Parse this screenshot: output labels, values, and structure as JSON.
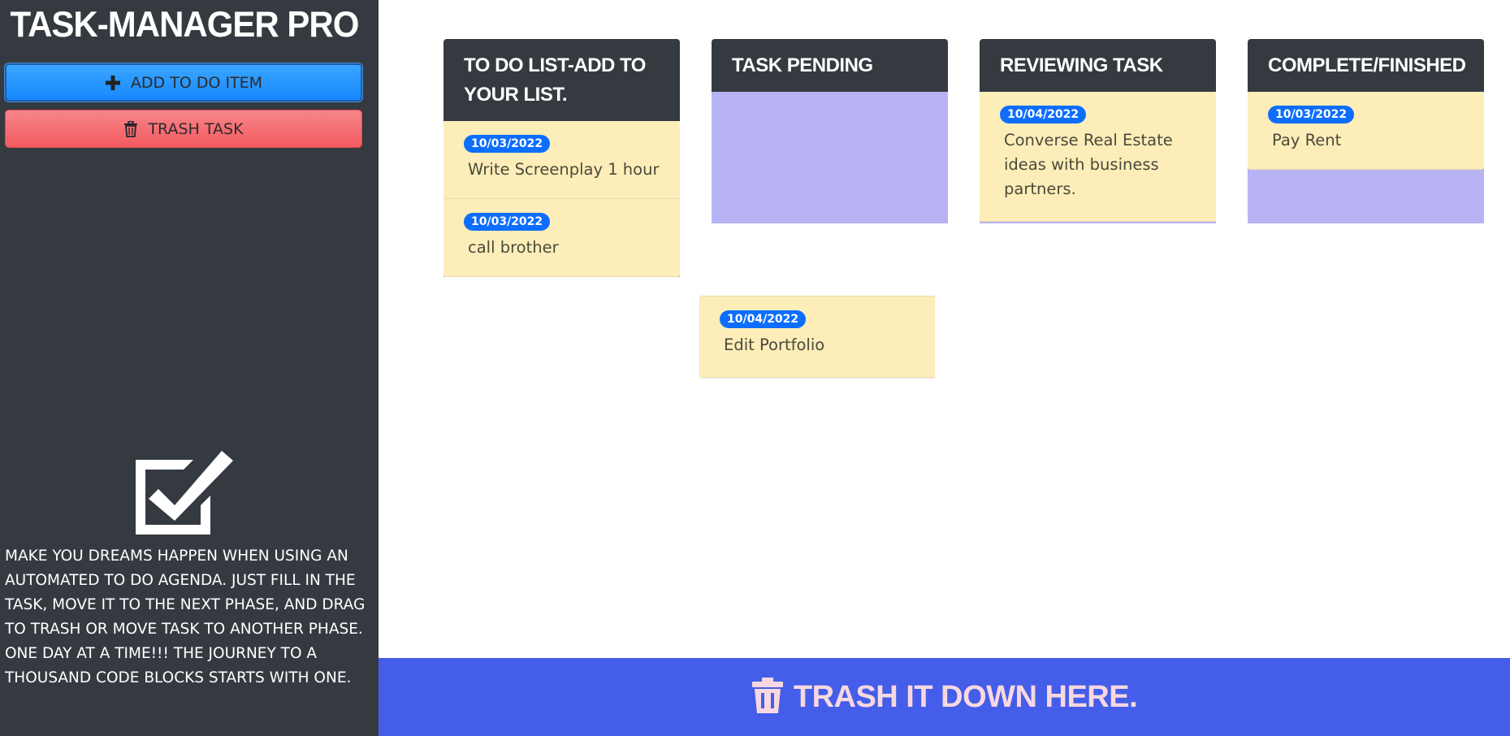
{
  "app": {
    "title": "TASK-MANAGER PRO"
  },
  "sidebar": {
    "add_button": {
      "label": "ADD TO DO ITEM",
      "icon": "plus-icon"
    },
    "trash_button": {
      "label": "TRASH TASK",
      "icon": "trash-icon"
    },
    "logo_icon": "checkbox-icon",
    "tagline": "MAKE YOU DREAMS HAPPEN WHEN USING AN AUTOMATED TO DO AGENDA. JUST FILL IN THE TASK, MOVE IT TO THE NEXT PHASE, AND DRAG TO TRASH OR MOVE TASK TO ANOTHER PHASE. ONE DAY AT A TIME!!! THE JOURNEY TO A THOUSAND CODE BLOCKS STARTS WITH ONE."
  },
  "columns": [
    {
      "title": "TO DO LIST-ADD TO YOUR LIST.",
      "cards": [
        {
          "date": "10/03/2022",
          "text": "Write Screenplay 1 hour"
        },
        {
          "date": "10/03/2022",
          "text": "call brother"
        }
      ]
    },
    {
      "title": "TASK PENDING",
      "cards": []
    },
    {
      "title": "REVIEWING TASK",
      "cards": [
        {
          "date": "10/04/2022",
          "text": "Converse Real Estate ideas with business partners."
        }
      ]
    },
    {
      "title": "COMPLETE/FINISHED",
      "cards": [
        {
          "date": "10/03/2022",
          "text": "Pay Rent"
        }
      ]
    }
  ],
  "dragging_card": {
    "date": "10/04/2022",
    "text": "Edit Portfolio"
  },
  "trash_zone": {
    "label": "TRASH IT DOWN HERE.",
    "icon": "trash-icon"
  },
  "colors": {
    "sidebar_bg": "#343a40",
    "card_bg": "#fdedb9",
    "column_body_bg": "#b8b3f5",
    "badge_bg": "#0d6efd",
    "trash_zone_bg": "#445eea",
    "add_button_bg": "#1788ff",
    "trash_button_bg": "#f25a5f"
  }
}
